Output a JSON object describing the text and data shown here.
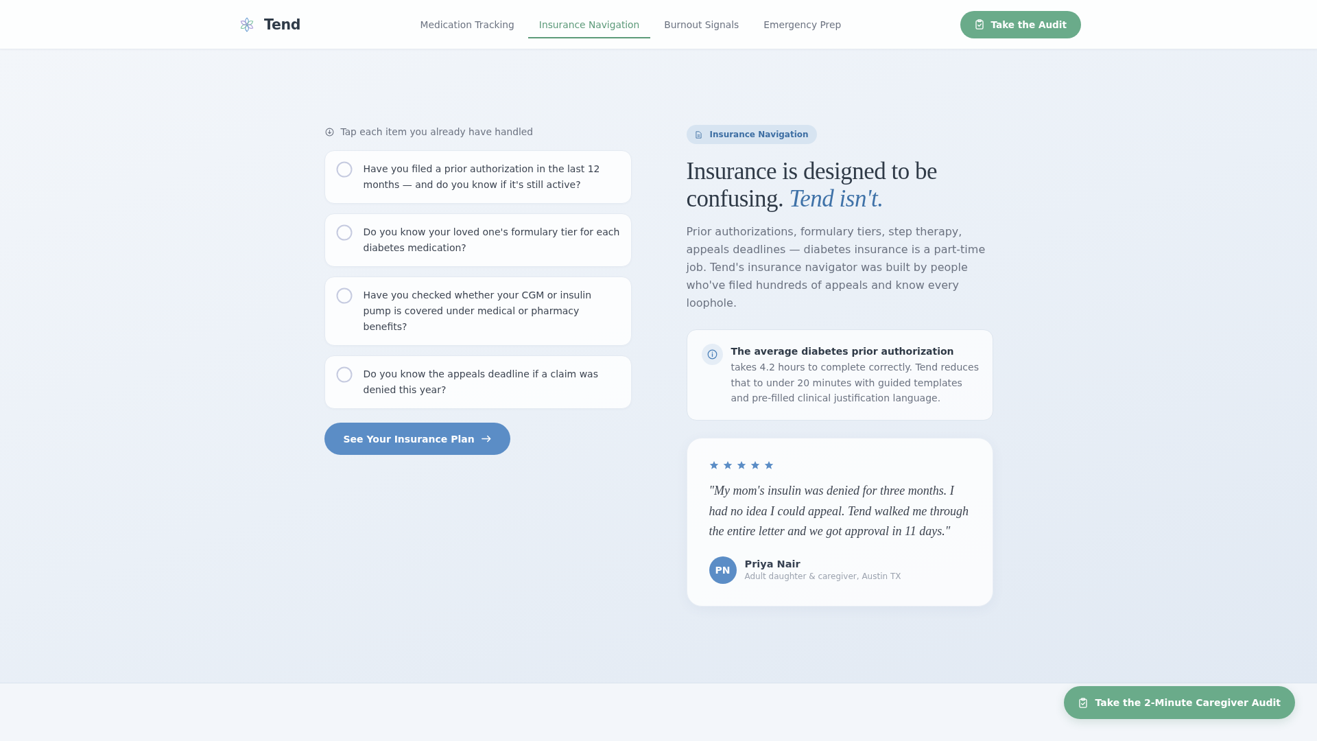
{
  "header": {
    "logo": "Tend",
    "nav": [
      {
        "label": "Medication Tracking",
        "selected": false
      },
      {
        "label": "Insurance Navigation",
        "selected": true
      },
      {
        "label": "Burnout Signals",
        "selected": false
      },
      {
        "label": "Emergency Prep",
        "selected": false
      }
    ],
    "cta": "Take the Audit"
  },
  "checklist": {
    "hint": "Tap each item you already have handled",
    "items": [
      {
        "text": "Have you filed a prior authorization in the last 12 months — and do you know if it's still active?",
        "checked": false
      },
      {
        "text": "Do you know your loved one's formulary tier for each diabetes medication?",
        "checked": false
      },
      {
        "text": "Have you checked whether your CGM or insulin pump is covered under medical or pharmacy benefits?",
        "checked": false
      },
      {
        "text": "Do you know the appeals deadline if a claim was denied this year?",
        "checked": false
      }
    ],
    "button": "See Your Insurance Plan"
  },
  "feature": {
    "badge": "Insurance Navigation",
    "heading": "Insurance is designed to be confusing. *Tend isn't.*",
    "description": "Prior authorizations, formulary tiers, step therapy, appeals deadlines — diabetes insurance is a part-time job. Tend's insurance navigator was built by people who've filed hundreds of appeals and know every loophole.",
    "callout": "**The average diabetes prior authorization** takes 4.2 hours to complete correctly. Tend reduces that to under 20 minutes with guided templates and pre-filled clinical justification language."
  },
  "testimonial": {
    "stars": 5,
    "quote": "\"My mom's insulin was denied for three months. I had no idea I could appeal. Tend walked me through the entire letter and we got approval in 11 days.\"",
    "initials": "PN",
    "name": "Priya Nair",
    "role": "Adult daughter & caregiver, Austin TX"
  },
  "floating_button": "Take the 2-Minute Caregiver Audit"
}
